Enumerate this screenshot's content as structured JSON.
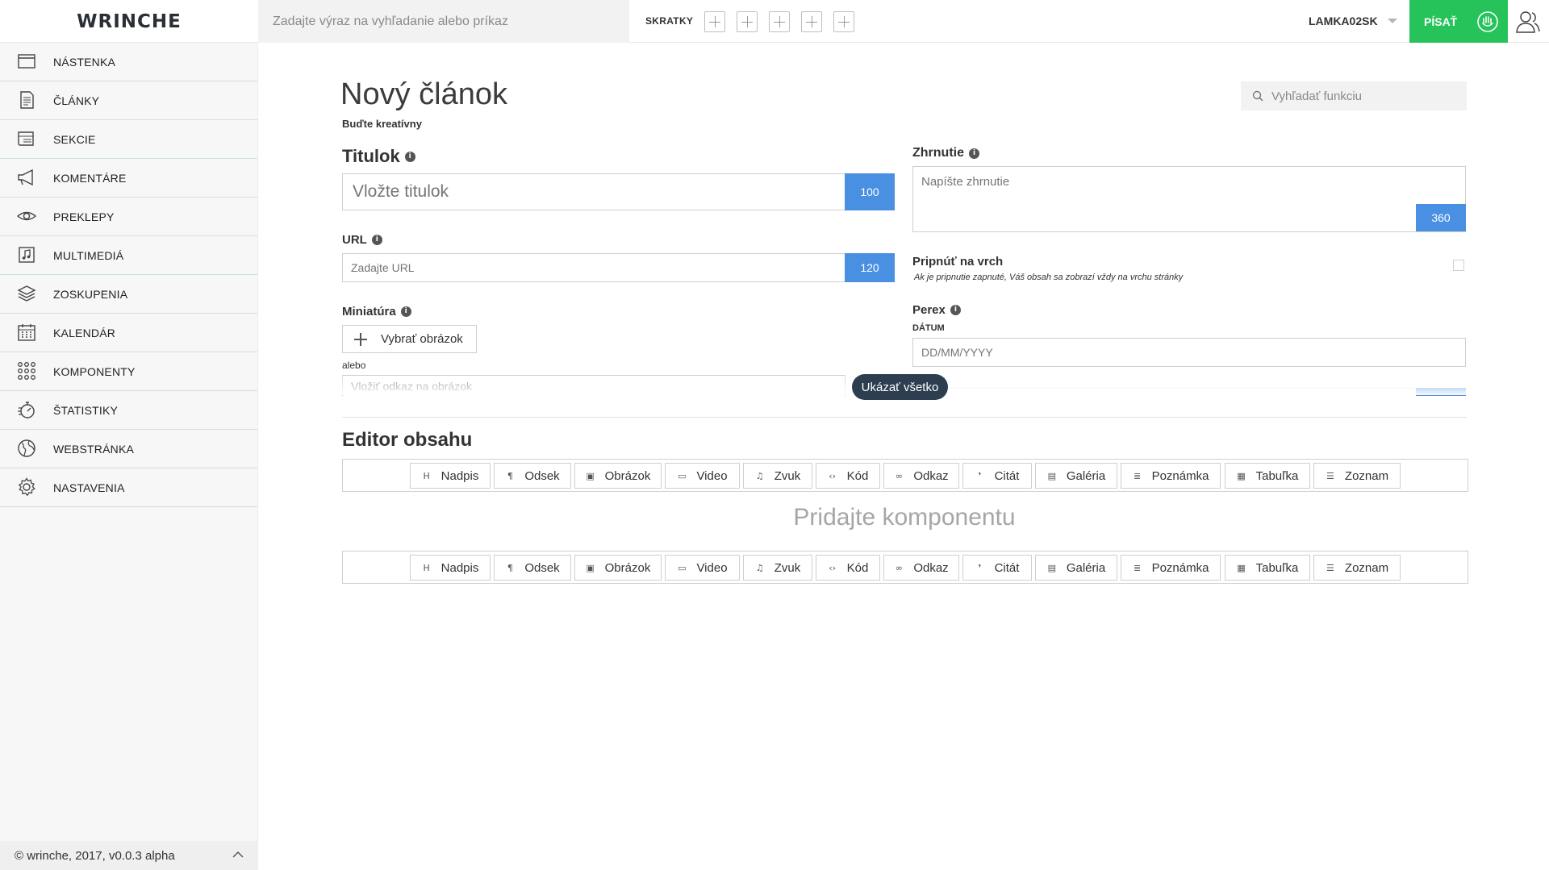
{
  "header": {
    "logo": "WRINCHE",
    "command_placeholder": "Zadajte výraz na vyhľadanie alebo príkaz",
    "shortcuts_label": "SKRATKY",
    "shortcut_slots": 5,
    "username": "LAMKA02SK",
    "write_button": "PÍSAŤ"
  },
  "sidebar": {
    "items": [
      {
        "label": "NÁSTENKA",
        "icon": "dashboard-icon"
      },
      {
        "label": "ČLÁNKY",
        "icon": "articles-icon"
      },
      {
        "label": "SEKCIE",
        "icon": "sections-icon"
      },
      {
        "label": "KOMENTÁRE",
        "icon": "megaphone-icon"
      },
      {
        "label": "PREKLEPY",
        "icon": "eye-icon"
      },
      {
        "label": "MULTIMEDIÁ",
        "icon": "music-icon"
      },
      {
        "label": "ZOSKUPENIA",
        "icon": "layers-icon"
      },
      {
        "label": "KALENDÁR",
        "icon": "calendar-icon"
      },
      {
        "label": "KOMPONENTY",
        "icon": "grid-icon"
      },
      {
        "label": "ŠTATISTIKY",
        "icon": "stopwatch-icon"
      },
      {
        "label": "WEBSTRÁNKA",
        "icon": "globe-icon"
      },
      {
        "label": "NASTAVENIA",
        "icon": "gear-icon"
      }
    ],
    "footer": "© wrinche, 2017, v0.0.3 alpha"
  },
  "main": {
    "title": "Nový článok",
    "subtitle": "Buďte kreatívny",
    "function_search_placeholder": "Vyhľadať funkciu",
    "title_field": {
      "label": "Titulok",
      "placeholder": "Vložte titulok",
      "counter": "100"
    },
    "url_field": {
      "label": "URL",
      "placeholder": "Zadajte URL",
      "counter": "120"
    },
    "thumbnail": {
      "label": "Miniatúra",
      "button": "Vybrať obrázok",
      "or": "alebo",
      "link_placeholder": "Vložiť odkaz na obrázok"
    },
    "summary": {
      "label": "Zhrnutie",
      "placeholder": "Napíšte zhrnutie",
      "counter": "360"
    },
    "pin": {
      "label": "Pripnúť na vrch",
      "hint": "Ak je pripnutie zapnuté, Váš obsah sa zobrazí vždy na vrchu stránky",
      "checked": false
    },
    "perex": {
      "label": "Perex",
      "date_label": "DÁTUM",
      "date_placeholder": "DD/MM/YYYY"
    },
    "show_all": "Ukázať všetko",
    "editor_title": "Editor obsahu",
    "add_component": "Pridajte komponentu",
    "tools": [
      {
        "label": "Nadpis",
        "icon": "heading-icon"
      },
      {
        "label": "Odsek",
        "icon": "paragraph-icon"
      },
      {
        "label": "Obrázok",
        "icon": "image-icon"
      },
      {
        "label": "Video",
        "icon": "video-icon"
      },
      {
        "label": "Zvuk",
        "icon": "audio-icon"
      },
      {
        "label": "Kód",
        "icon": "code-icon"
      },
      {
        "label": "Odkaz",
        "icon": "link-icon"
      },
      {
        "label": "Citát",
        "icon": "quote-icon"
      },
      {
        "label": "Galéria",
        "icon": "gallery-icon"
      },
      {
        "label": "Poznámka",
        "icon": "note-icon"
      },
      {
        "label": "Tabuľka",
        "icon": "table-icon"
      },
      {
        "label": "Zoznam",
        "icon": "list-icon"
      }
    ]
  },
  "colors": {
    "accent_green": "#26c35a",
    "counter_blue": "#4a90e2",
    "dark_pill": "#2c3e50"
  }
}
